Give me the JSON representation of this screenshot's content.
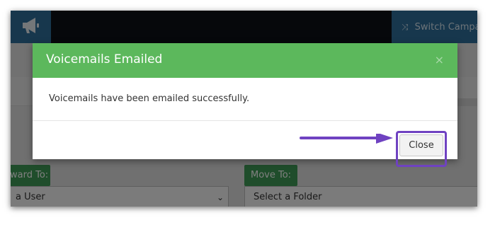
{
  "header": {
    "switch_button_label": "Switch Campa",
    "icons": {
      "logo": "megaphone-icon",
      "switch": "shuffle-icon"
    }
  },
  "form": {
    "forward_to_label": "ward To:",
    "forward_to_select_value": "a User",
    "move_to_label": "Move To:",
    "move_to_select_value": "Select a Folder"
  },
  "modal": {
    "title": "Voicemails Emailed",
    "close_x": "×",
    "message": "Voicemails have been emailed successfully.",
    "close_button_label": "Close"
  },
  "colors": {
    "modal_header": "#5cb85c",
    "highlight": "#6f42c1",
    "topbar": "#0c1016",
    "accent_blue": "#2f6f9b",
    "label_green": "#3f9b56"
  }
}
